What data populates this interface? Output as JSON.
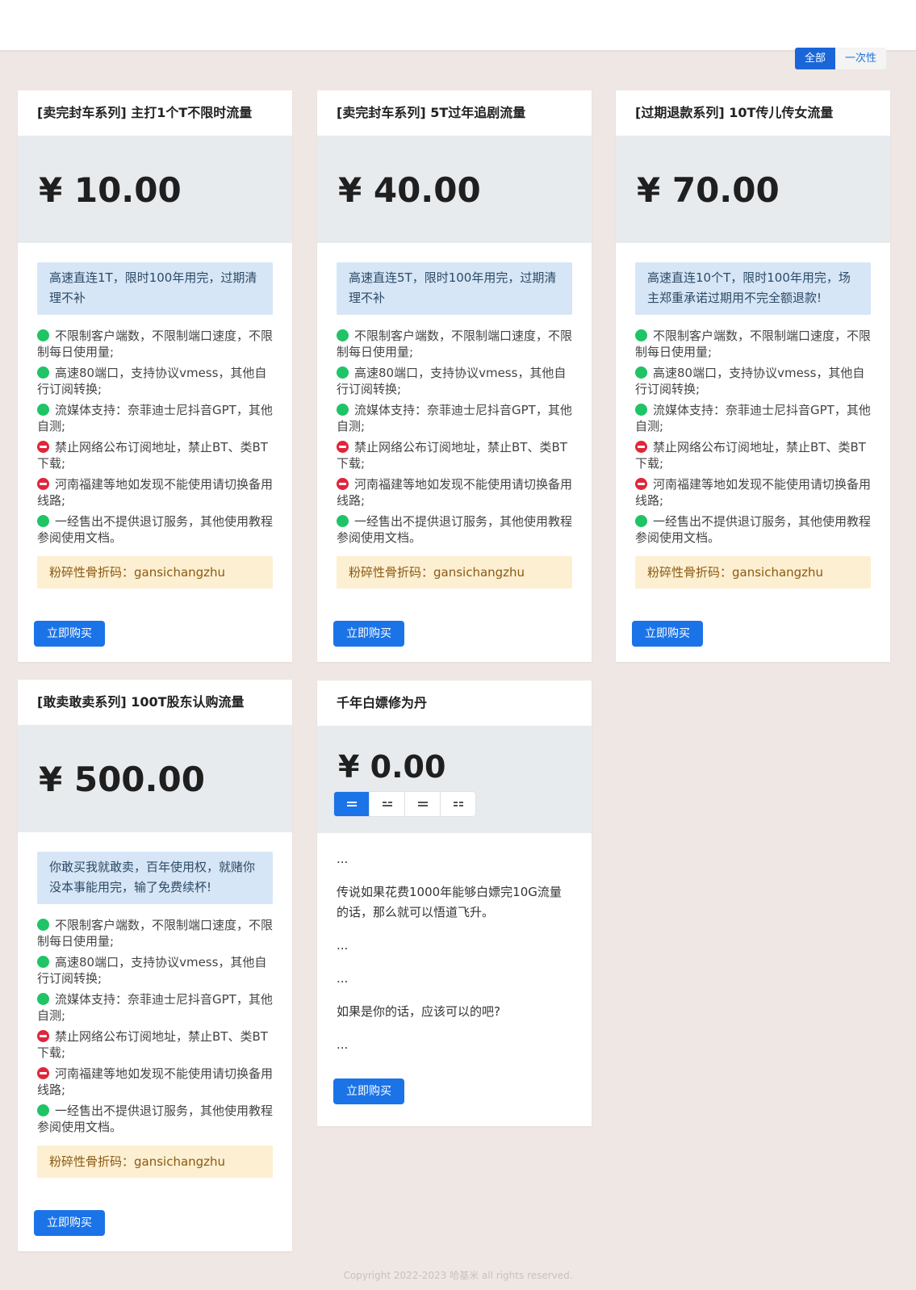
{
  "filters": [
    "全部",
    "一次性"
  ],
  "buy_label": "立即购买",
  "plans": [
    {
      "title": "[卖完封车系列] 主打1个T不限时流量",
      "price": "¥ 10.00",
      "info": "高速直连1T，限时100年用完，过期清理不补",
      "coupon": "粉碎性骨折码：gansichangzhu"
    },
    {
      "title": "[卖完封车系列] 5T过年追剧流量",
      "price": "¥ 40.00",
      "info": "高速直连5T，限时100年用完，过期清理不补",
      "coupon": "粉碎性骨折码：gansichangzhu"
    },
    {
      "title": "[过期退款系列] 10T传儿传女流量",
      "price": "¥ 70.00",
      "info": "高速直连10个T，限时100年用完，场主郑重承诺过期用不完全额退款!",
      "coupon": "粉碎性骨折码：gansichangzhu"
    },
    {
      "title": "[敢卖敢卖系列] 100T股东认购流量",
      "price": "¥ 500.00",
      "info": "你敢买我就敢卖，百年使用权，就赌你没本事能用完，输了免费续杯!",
      "coupon": "粉碎性骨折码：gansichangzhu"
    }
  ],
  "features": [
    {
      "status": "ok",
      "text": "不限制客户端数，不限制端口速度，不限制每日使用量;"
    },
    {
      "status": "ok",
      "text": "高速80端口，支持协议vmess，其他自行订阅转换;"
    },
    {
      "status": "ok",
      "text": "流媒体支持：奈菲迪士尼抖音GPT，其他自测;"
    },
    {
      "status": "no",
      "text": "禁止网络公布订阅地址，禁止BT、类BT下载;"
    },
    {
      "status": "no",
      "text": "河南福建等地如发现不能使用请切换备用线路;"
    },
    {
      "status": "ok",
      "text": "一经售出不提供退订服务，其他使用教程参阅使用文档。"
    }
  ],
  "free_plan": {
    "title": "千年白嫖修为丹",
    "price": "¥ 0.00",
    "paragraphs": [
      "...",
      "传说如果花费1000年能够白嫖完10G流量的话，那么就可以悟道飞升。",
      "...",
      "...",
      "如果是你的话，应该可以的吧?",
      "..."
    ]
  },
  "footer": "Copyright 2022-2023 哈基米 all rights reserved."
}
